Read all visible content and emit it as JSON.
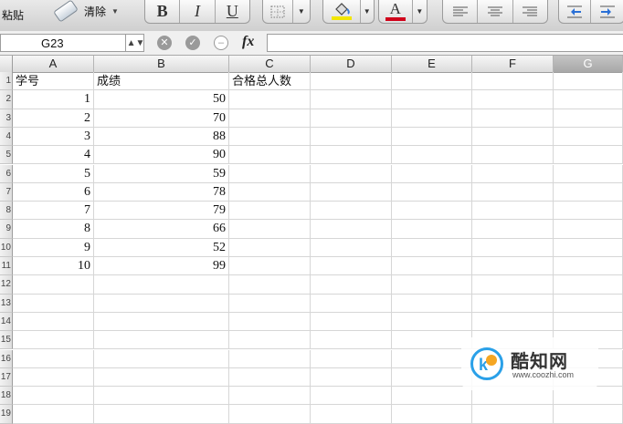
{
  "toolbar": {
    "paste_label": "粘贴",
    "clear_label": "清除",
    "bold_label": "B",
    "italic_label": "I",
    "underline_label": "U",
    "font_color_letter": "A",
    "fill_color": "#f2e600",
    "font_color": "#d0021b"
  },
  "formula_bar": {
    "name_box": "G23",
    "fx_label": "fx",
    "formula": ""
  },
  "sheet": {
    "columns": [
      "A",
      "B",
      "C",
      "D",
      "E",
      "F",
      "G"
    ],
    "selected_column": "G",
    "rows": [
      {
        "n": "1",
        "a": "学号",
        "b": "成绩",
        "c": "合格总人数"
      },
      {
        "n": "2",
        "a": "1",
        "b": "50",
        "c": ""
      },
      {
        "n": "3",
        "a": "2",
        "b": "70",
        "c": ""
      },
      {
        "n": "4",
        "a": "3",
        "b": "88",
        "c": ""
      },
      {
        "n": "5",
        "a": "4",
        "b": "90",
        "c": ""
      },
      {
        "n": "6",
        "a": "5",
        "b": "59",
        "c": ""
      },
      {
        "n": "7",
        "a": "6",
        "b": "78",
        "c": ""
      },
      {
        "n": "8",
        "a": "7",
        "b": "79",
        "c": ""
      },
      {
        "n": "9",
        "a": "8",
        "b": "66",
        "c": ""
      },
      {
        "n": "10",
        "a": "9",
        "b": "52",
        "c": ""
      },
      {
        "n": "11",
        "a": "10",
        "b": "99",
        "c": ""
      },
      {
        "n": "12",
        "a": "",
        "b": "",
        "c": ""
      },
      {
        "n": "13",
        "a": "",
        "b": "",
        "c": ""
      },
      {
        "n": "14",
        "a": "",
        "b": "",
        "c": ""
      },
      {
        "n": "15",
        "a": "",
        "b": "",
        "c": ""
      },
      {
        "n": "16",
        "a": "",
        "b": "",
        "c": ""
      },
      {
        "n": "17",
        "a": "",
        "b": "",
        "c": ""
      },
      {
        "n": "18",
        "a": "",
        "b": "",
        "c": ""
      },
      {
        "n": "19",
        "a": "",
        "b": "",
        "c": ""
      }
    ]
  },
  "watermark": {
    "title": "酷知网",
    "url": "www.coozhi.com"
  }
}
